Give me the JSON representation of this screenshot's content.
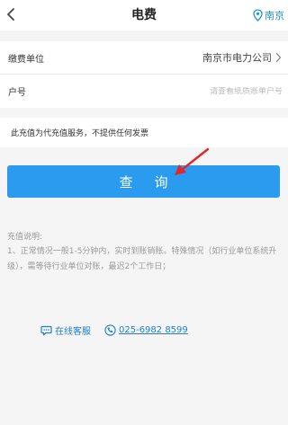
{
  "header": {
    "title": "电费",
    "back_icon": "chevron-left-icon",
    "city": "南京",
    "city_icon": "location-pin-icon"
  },
  "form": {
    "unit_label": "缴费单位",
    "unit_value": "南京市电力公司",
    "account_label": "户号",
    "account_value": "",
    "account_placeholder": "请查看纸质账单户号"
  },
  "notice": "此充值为代充值服务，不提供任何发票",
  "query_button": "查询",
  "tips": {
    "title": "充值说明:",
    "line1": "1、正常情况一般1-5分钟内，实时到账销账。特殊情况（如行业单位系统升级），需等待行业单位对账，最迟2个工作日；"
  },
  "contact": {
    "online_service": "在线客服",
    "phone": "025-6982 8599",
    "accent_color": "#1e7fd0"
  },
  "colors": {
    "primary": "#2a9bee",
    "background": "#f5f5f5",
    "annotation_arrow": "#e5262a"
  }
}
